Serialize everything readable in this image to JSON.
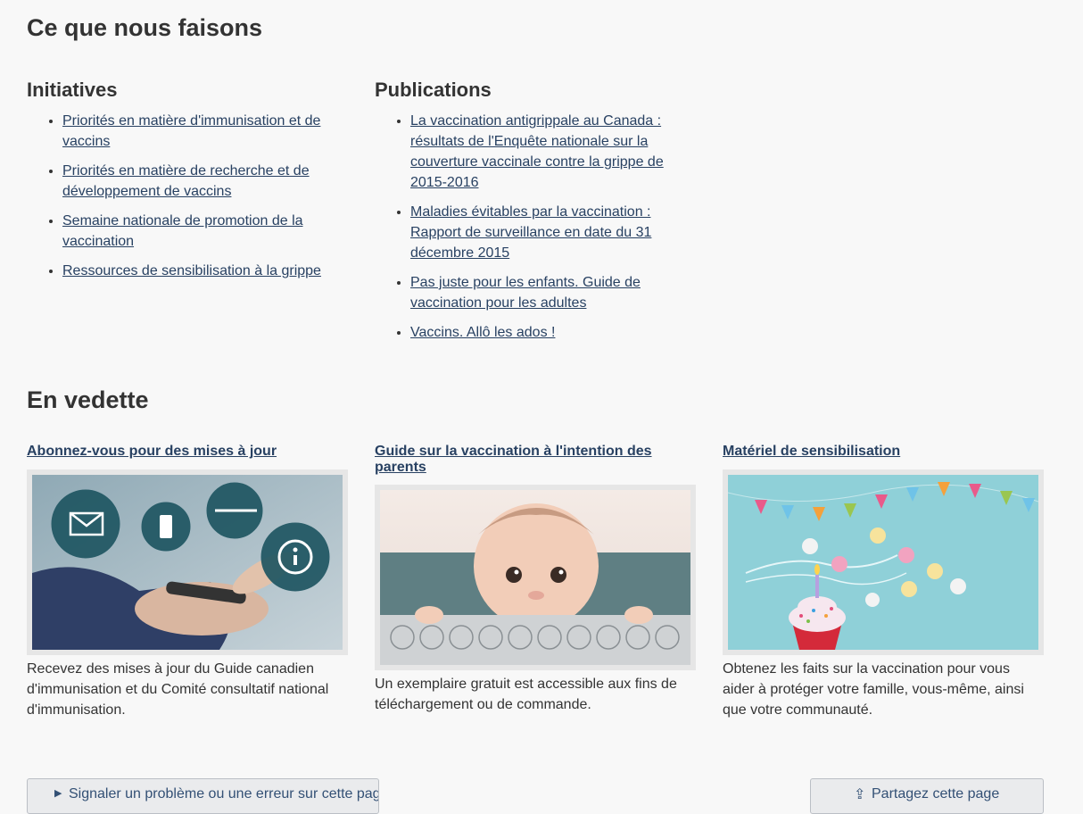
{
  "what_we_do": {
    "title": "Ce que nous faisons",
    "initiatives": {
      "title": "Initiatives",
      "items": [
        "Priorités en matière d'immunisation et de vaccins",
        "Priorités en matière de recherche et de développement de vaccins",
        "Semaine nationale de promotion de la vaccination",
        "Ressources de sensibilisation à la grippe"
      ]
    },
    "publications": {
      "title": "Publications",
      "items": [
        "La vaccination antigrippale au Canada : résultats de l'Enquête nationale sur la couverture vaccinale contre la grippe de 2015-2016",
        "Maladies évitables par la vaccination : Rapport de surveillance en date du 31 décembre 2015",
        "Pas juste pour les enfants. Guide de vaccination pour les adultes",
        "Vaccins. Allô les ados !"
      ]
    }
  },
  "featured": {
    "title": "En vedette",
    "items": [
      {
        "title": "Abonnez-vous pour des mises à jour",
        "text": "Recevez des mises à jour du Guide canadien d'immunisation et du Comité consultatif national d'immunisation."
      },
      {
        "title": "Guide sur la vaccination à l'intention des parents",
        "text": "Un exemplaire gratuit est accessible aux fins de téléchargement ou de commande."
      },
      {
        "title": "Matériel de sensibilisation",
        "text": "Obtenez les faits sur la vaccination pour vous aider à protéger votre famille, vous-même, ainsi que votre communauté."
      }
    ]
  },
  "footer_buttons": {
    "report": "Signaler un problème ou une erreur sur cette page",
    "share": "Partagez cette page"
  },
  "colors": {
    "link": "#284162",
    "text": "#333333",
    "background": "#f8f8f8"
  }
}
